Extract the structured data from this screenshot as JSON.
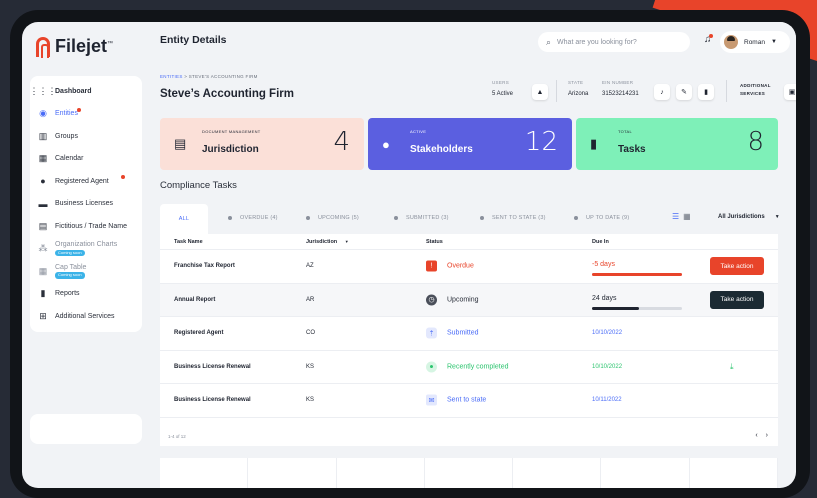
{
  "app": {
    "name": "Filejet",
    "tm": "™"
  },
  "sidebar": {
    "items": [
      {
        "label": "Dashboard",
        "icon": "grid-icon"
      },
      {
        "label": "Entities",
        "icon": "globe-icon",
        "active": true,
        "badge": true
      },
      {
        "label": "Groups",
        "icon": "building-icon"
      },
      {
        "label": "Calendar",
        "icon": "calendar-icon"
      },
      {
        "label": "Registered Agent",
        "icon": "users-icon",
        "badge": true
      },
      {
        "label": "Business Licenses",
        "icon": "license-icon"
      },
      {
        "label": "Fictitious / Trade Name",
        "icon": "tag-icon"
      },
      {
        "label": "Organization Charts",
        "icon": "org-chart-icon",
        "coming": "Coming soon"
      },
      {
        "label": "Cap Table",
        "icon": "table-icon",
        "coming": "Coming soon"
      },
      {
        "label": "Reports",
        "icon": "report-icon"
      },
      {
        "label": "Additional Services",
        "icon": "plus-box-icon"
      }
    ]
  },
  "header": {
    "title": "Entity Details",
    "search_placeholder": "What are you looking for?",
    "user_name": "Roman"
  },
  "entity": {
    "breadcrumb_root": "ENTITIES",
    "breadcrumb_sep": ">",
    "breadcrumb_current": "STEVE'S ACCOUNTING FIRM",
    "name": "Steve’s Accounting Firm",
    "users_label": "USERS",
    "users_value": "5 Active",
    "state_label": "STATE",
    "state_value": "Arizona",
    "ein_label": "EIN NUMBER",
    "ein_value": "31523214231",
    "additional_label_1": "ADDITIONAL",
    "additional_label_2": "SERVICES"
  },
  "cards": [
    {
      "small": "DOCUMENT MANAGEMENT",
      "label": "Jurisdiction",
      "value": "4",
      "bg": "#fbe0d8",
      "fg": "#1f2430"
    },
    {
      "small": "ACTIVE",
      "label": "Stakeholders",
      "value": "12",
      "bg": "#5b5fe0",
      "fg": "#ffffff"
    },
    {
      "small": "TOTAL",
      "label": "Tasks",
      "value": "8",
      "bg": "#7ef0b8",
      "fg": "#1f2430"
    }
  ],
  "compliance": {
    "title": "Compliance Tasks",
    "tabs": [
      "ALL",
      "OVERDUE (4)",
      "UPCOMING (5)",
      "SUBMITTED (3)",
      "SENT TO STATE (3)",
      "UP TO DATE (9)"
    ],
    "filter": "All Jurisdictions",
    "columns": [
      "Task Name",
      "Jurisdiction",
      "Status",
      "Due In"
    ],
    "rows": [
      {
        "task": "Franchise Tax Report",
        "jur": "AZ",
        "status": "Overdue",
        "due": "-5 days",
        "action": "Take action"
      },
      {
        "task": "Annual Report",
        "jur": "AR",
        "status": "Upcoming",
        "due": "24 days",
        "action": "Take action"
      },
      {
        "task": "Registered Agent",
        "jur": "CO",
        "status": "Submitted",
        "due": "10/10/2022",
        "action": ""
      },
      {
        "task": "Business License Renewal",
        "jur": "KS",
        "status": "Recently completed",
        "due": "10/10/2022",
        "action": ""
      },
      {
        "task": "Business License Renewal",
        "jur": "KS",
        "status": "Sent to state",
        "due": "10/11/2022",
        "action": ""
      }
    ],
    "footer": "1-4 of 12",
    "overdue_progress": 1.0,
    "upcoming_progress": 0.52
  },
  "colors": {
    "accent": "#4a6cf7",
    "danger": "#e8442a",
    "dark": "#1b2a33",
    "success": "#2bc46e"
  }
}
